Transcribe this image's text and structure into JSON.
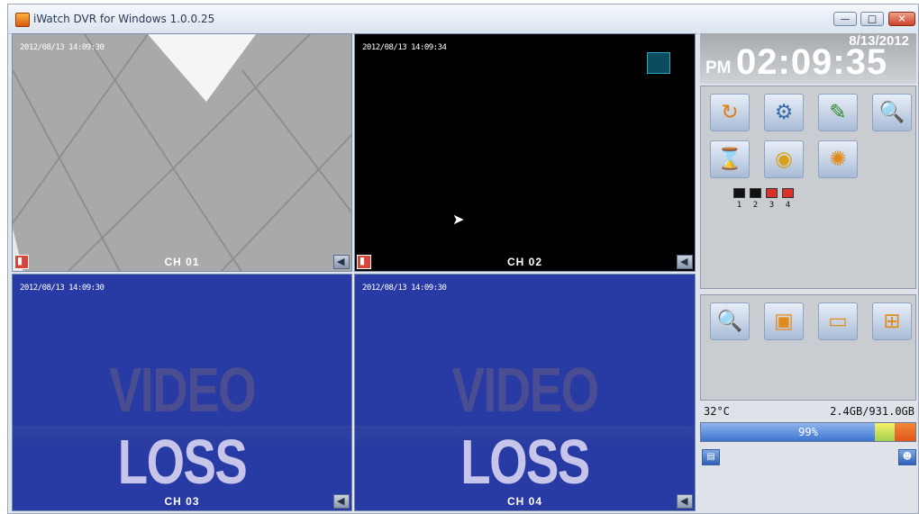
{
  "window": {
    "title": "iWatch DVR for Windows 1.0.0.25",
    "buttons": {
      "minimize": "—",
      "maximize": "□",
      "close": "✕"
    }
  },
  "cameras": [
    {
      "label": "CH 01",
      "timestamp": "2012/08/13 14:09:30",
      "state": "live"
    },
    {
      "label": "CH 02",
      "timestamp": "2012/08/13 14:09:34",
      "state": "live-dark"
    },
    {
      "label": "CH 03",
      "timestamp": "2012/08/13 14:09:30",
      "state": "video-loss"
    },
    {
      "label": "CH 04",
      "timestamp": "2012/08/13 14:09:30",
      "state": "video-loss"
    }
  ],
  "video_loss": {
    "word1": "VIDEO",
    "word2": "LOSS"
  },
  "clock": {
    "date": "8/13/2012",
    "ampm": "PM",
    "time": "02:09:35"
  },
  "toolbar_top": [
    {
      "name": "playback-icon",
      "glyph": "↻"
    },
    {
      "name": "network-icon",
      "glyph": "⚙"
    },
    {
      "name": "log-icon",
      "glyph": "✎"
    },
    {
      "name": "search-icon",
      "glyph": "🔍"
    },
    {
      "name": "backup-icon",
      "glyph": "⌛"
    },
    {
      "name": "ptz-icon",
      "glyph": "◉"
    },
    {
      "name": "settings-icon",
      "glyph": "✺"
    }
  ],
  "channel_status": {
    "squares": [
      "#111111",
      "#111111",
      "#d8322a",
      "#d8322a"
    ],
    "numbers": [
      "1",
      "2",
      "3",
      "4"
    ]
  },
  "toolbar_bottom": [
    {
      "name": "zoom-icon",
      "glyph": "🔍"
    },
    {
      "name": "single-view-icon",
      "glyph": "▣"
    },
    {
      "name": "full-view-icon",
      "glyph": "▭"
    },
    {
      "name": "quad-view-icon",
      "glyph": "⊞"
    }
  ],
  "hdd": {
    "temperature": "32°C",
    "capacity": "2.4GB/931.0GB",
    "usage_text": "99%",
    "usage_fraction": 0.99
  },
  "colors": {
    "video_loss_bg": "#283aa3",
    "record_red": "#d8433a"
  }
}
